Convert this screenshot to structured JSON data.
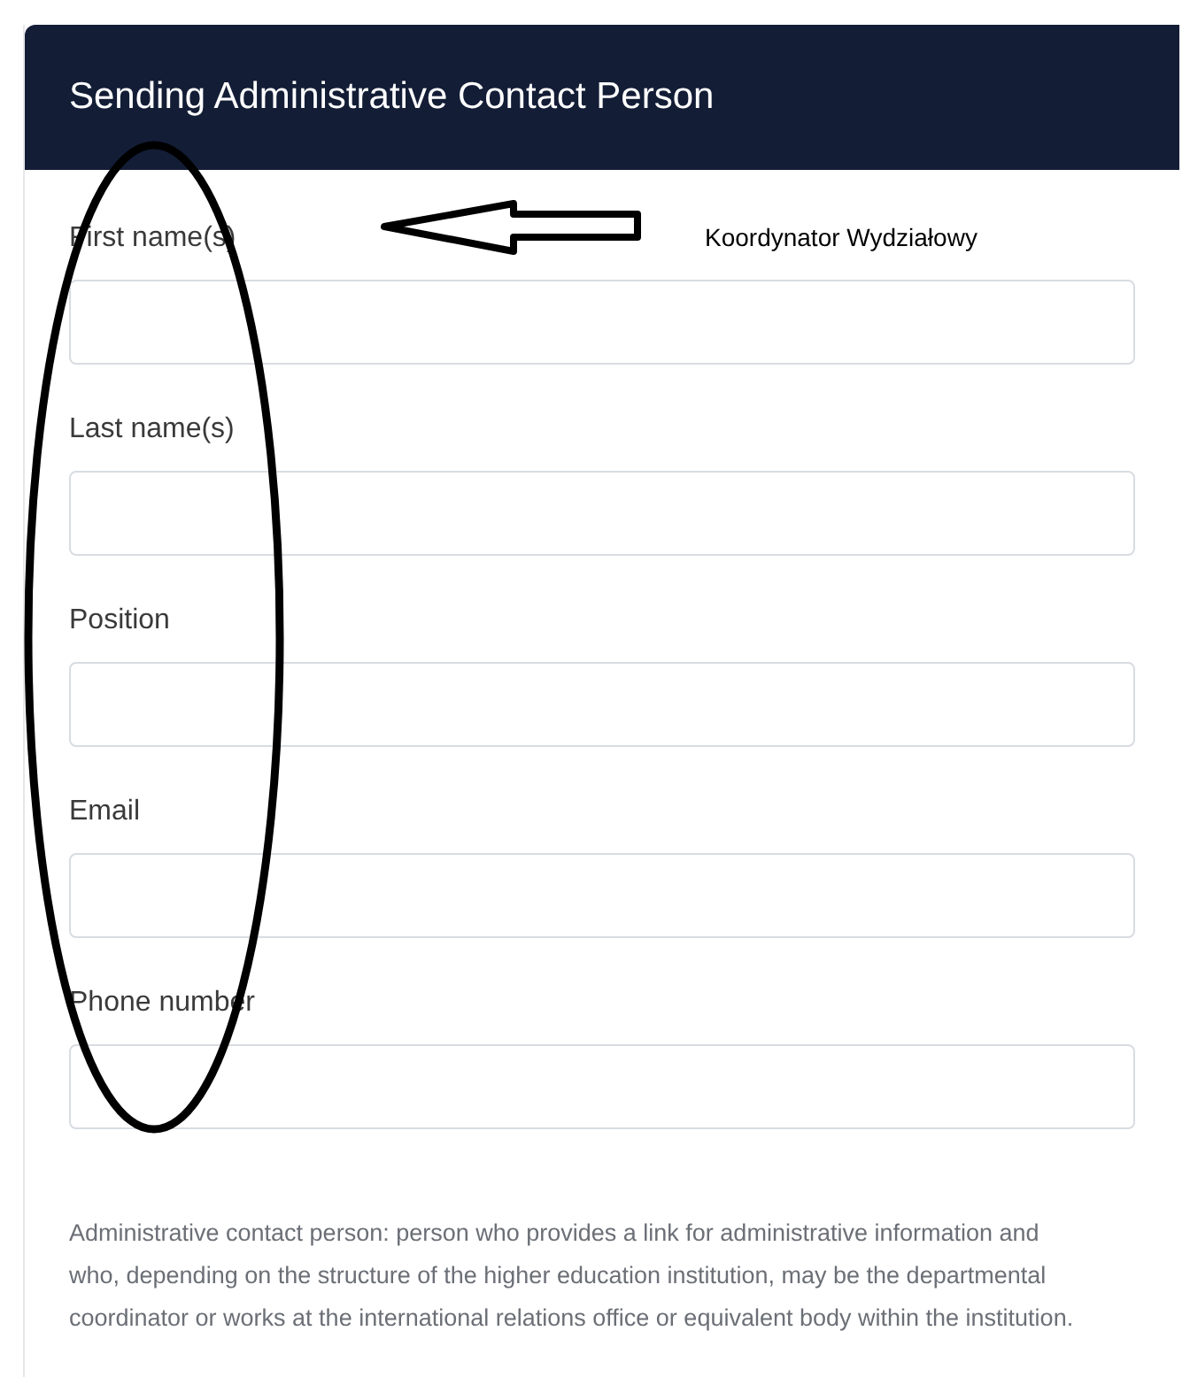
{
  "panel": {
    "title": "Sending Administrative Contact Person"
  },
  "fields": [
    {
      "label": "First name(s)"
    },
    {
      "label": "Last name(s)"
    },
    {
      "label": "Position"
    },
    {
      "label": "Email"
    },
    {
      "label": "Phone number"
    }
  ],
  "help_text": "Administrative contact person: person who provides a link for administrative information and who, depending on the structure of the higher education institution, may be the departmental coordinator or works at the international relations office or equivalent body within the institution.",
  "annotation": {
    "note": "Koordynator Wydziałowy"
  }
}
